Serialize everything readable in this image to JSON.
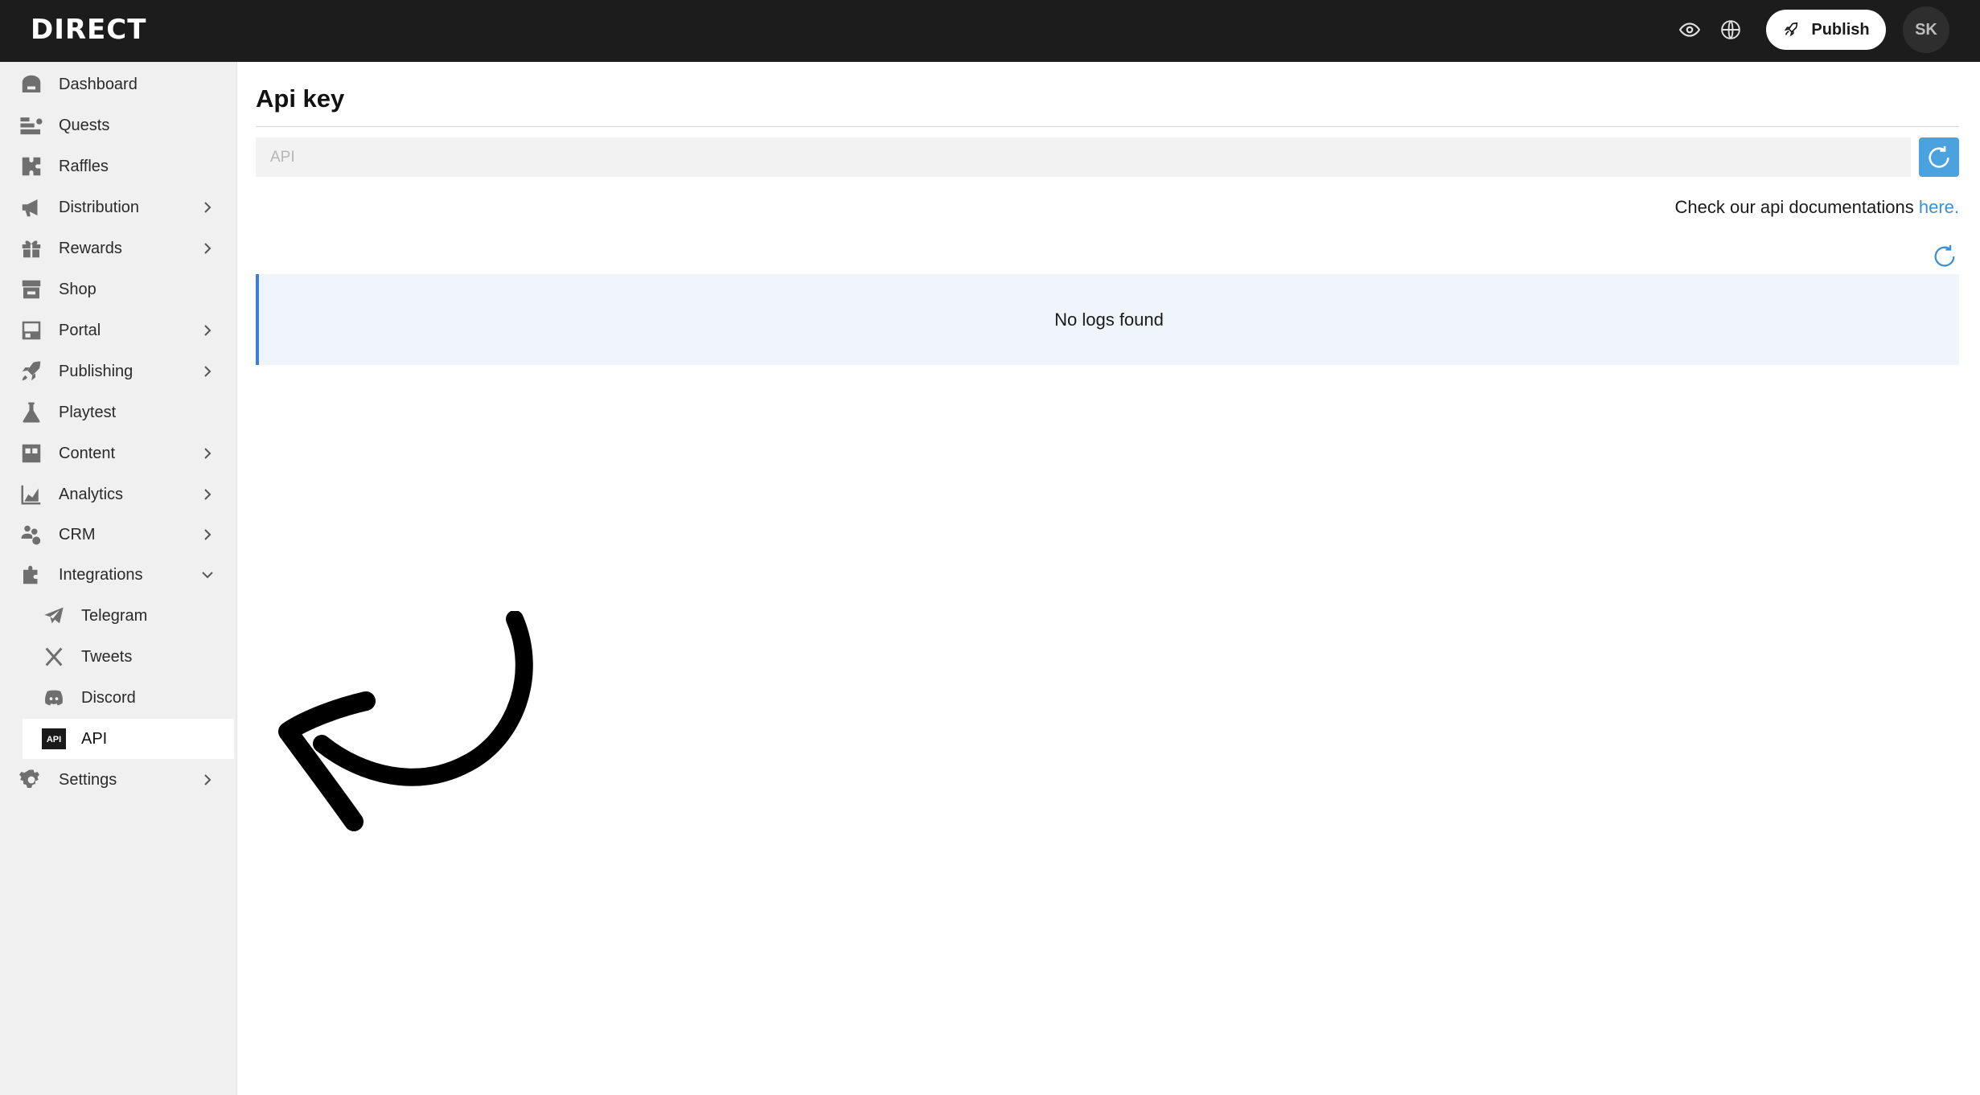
{
  "brand": {
    "logo_text": "DIRECT"
  },
  "topbar": {
    "icons": [
      "eye-icon",
      "globe-icon"
    ],
    "publish_label": "Publish",
    "avatar_initials": "SK"
  },
  "sidebar": {
    "items": [
      {
        "label": "Dashboard",
        "icon": "home-icon",
        "chevron": ""
      },
      {
        "label": "Quests",
        "icon": "quests-icon",
        "chevron": ""
      },
      {
        "label": "Raffles",
        "icon": "puzzle-icon",
        "chevron": ""
      },
      {
        "label": "Distribution",
        "icon": "megaphone-icon",
        "chevron": "right"
      },
      {
        "label": "Rewards",
        "icon": "gift-icon",
        "chevron": "right"
      },
      {
        "label": "Shop",
        "icon": "store-icon",
        "chevron": ""
      },
      {
        "label": "Portal",
        "icon": "portal-icon",
        "chevron": "right"
      },
      {
        "label": "Publishing",
        "icon": "rocket-icon",
        "chevron": "right"
      },
      {
        "label": "Playtest",
        "icon": "flask-icon",
        "chevron": ""
      },
      {
        "label": "Content",
        "icon": "quote-icon",
        "chevron": "right"
      },
      {
        "label": "Analytics",
        "icon": "chart-icon",
        "chevron": "right"
      },
      {
        "label": "CRM",
        "icon": "users-icon",
        "chevron": "right"
      },
      {
        "label": "Integrations",
        "icon": "puzzle-piece-icon",
        "chevron": "down"
      }
    ],
    "sub_items": [
      {
        "label": "Telegram",
        "icon": "telegram-icon"
      },
      {
        "label": "Tweets",
        "icon": "x-icon"
      },
      {
        "label": "Discord",
        "icon": "discord-icon"
      },
      {
        "label": "API",
        "icon": "api-icon",
        "active": true
      }
    ],
    "settings": {
      "label": "Settings",
      "icon": "gear-icon",
      "chevron": "right"
    }
  },
  "main": {
    "title": "Api key",
    "api_input": {
      "placeholder": "API",
      "value": ""
    },
    "docs_text": "Check our api documentations ",
    "docs_link": "here.",
    "empty_logs": "No logs found"
  },
  "colors": {
    "topbar": "#1c1c1c",
    "sidebar": "#f0f0f1",
    "accent": "#4aa3df",
    "link": "#3a8fd6",
    "logs_bg": "#f0f5fc",
    "logs_border": "#3e7fd6"
  }
}
